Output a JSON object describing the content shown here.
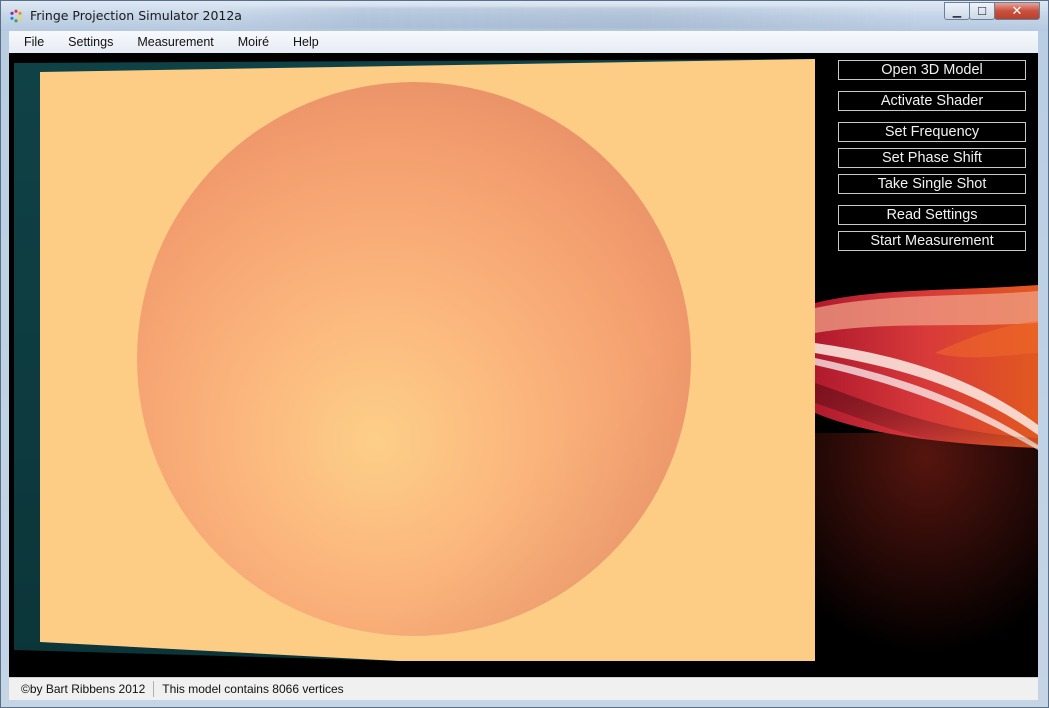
{
  "window": {
    "title": "Fringe Projection Simulator 2012a",
    "minimize_glyph": "▁",
    "maximize_glyph": "☐",
    "close_glyph": "✕"
  },
  "menu": {
    "items": [
      "File",
      "Settings",
      "Measurement",
      "Moiré",
      "Help"
    ]
  },
  "panel": {
    "buttons": [
      "Open 3D Model",
      "Activate Shader",
      "Set Frequency",
      "Set Phase Shift",
      "Take Single Shot",
      "Read Settings",
      "Start Measurement"
    ]
  },
  "status": {
    "copyright": "©by Bart Ribbens 2012",
    "vertices": "This model contains 8066 vertices"
  },
  "colors": {
    "plane": "#fdcd86",
    "sphere_light": "#fdcb84",
    "sphere_dark": "#f09a6c",
    "background_teal": "#0e3d42",
    "button_border": "#c9c9c9",
    "accent_red": "#c8283c"
  },
  "icons": {
    "app": "gear-icon"
  }
}
